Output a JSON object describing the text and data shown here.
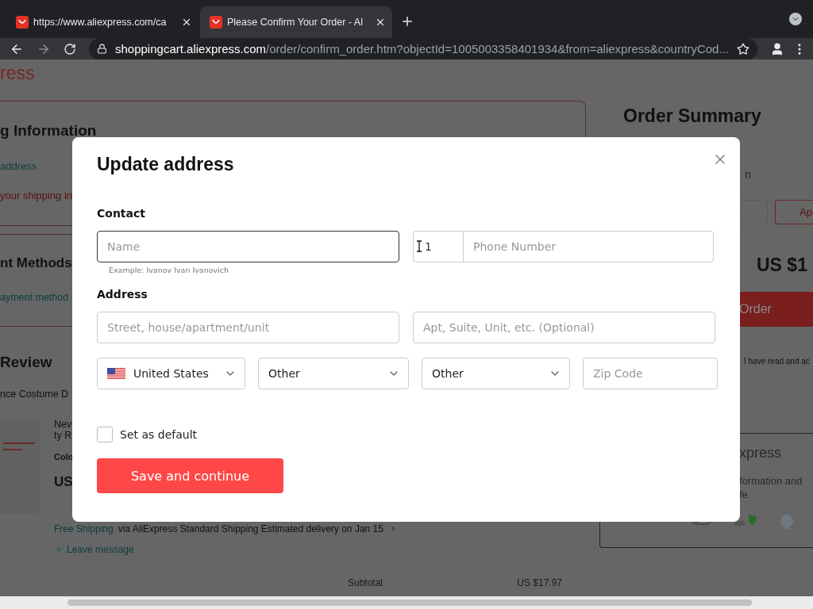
{
  "browser": {
    "tabs": [
      {
        "title": "https://www.aliexpress.com/ca",
        "selected": false
      },
      {
        "title": "Please Confirm Your Order - Al",
        "selected": true
      }
    ],
    "url": {
      "host": "shoppingcart.aliexpress.com",
      "path": "/order/confirm_order.htm?objectId=1005003358401934&from=aliexpress&countryCod..."
    }
  },
  "page": {
    "logo": "ress",
    "shipping": {
      "title": "g Information",
      "link": "address",
      "warning": "your shipping in"
    },
    "payment": {
      "title": "nt Methods",
      "link": "ayment method"
    },
    "review": {
      "title": "Review",
      "store": "nce Costume D",
      "product_lines": [
        "Nev",
        "ty R"
      ],
      "color_label": "Colo",
      "price": "US ",
      "free_shipping": "Free Shipping",
      "shipping_info": "via AliExpress Standard Shipping  Estimated delivery on Jan 15",
      "leave_message": "Leave message",
      "subtotal_label": "Subtotal",
      "subtotal": "US $17.97"
    },
    "summary": {
      "title": "Order Summary",
      "fragment": "n",
      "apply": "Ap",
      "total": "US $1",
      "order_button": "Order",
      "terms": "I have read and ac",
      "promo_title": "xpress",
      "promo_lines": [
        "formation and",
        "fe"
      ]
    }
  },
  "modal": {
    "title": "Update address",
    "contact_label": "Contact",
    "name": {
      "placeholder": "Name",
      "focused": true,
      "hint": "Example: Ivanov Ivan Ivanovich"
    },
    "phone": {
      "prefix": "1",
      "placeholder": "Phone Number"
    },
    "address_label": "Address",
    "street": {
      "placeholder": "Street, house/apartment/unit"
    },
    "apt": {
      "placeholder": "Apt, Suite, Unit, etc. (Optional)"
    },
    "selects": [
      {
        "kind": "country",
        "value": "United States"
      },
      {
        "kind": "plain",
        "value": "Other"
      },
      {
        "kind": "plain",
        "value": "Other"
      }
    ],
    "zip": {
      "placeholder": "Zip Code"
    },
    "default": {
      "label": "Set as default",
      "checked": false
    },
    "save": "Save and continue"
  }
}
